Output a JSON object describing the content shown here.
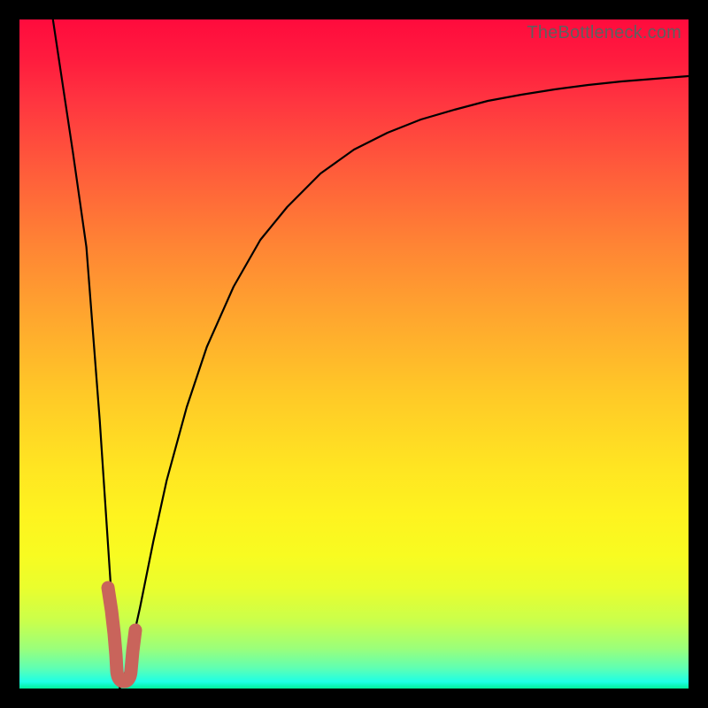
{
  "attribution": "TheBottleneck.com",
  "colors": {
    "frame": "#000000",
    "curve_stroke": "#000000",
    "marker_stroke": "#c9645b",
    "gradient_top": "#ff0b3d",
    "gradient_bottom": "#00ee9a"
  },
  "chart_data": {
    "type": "line",
    "title": "",
    "xlabel": "",
    "ylabel": "",
    "xlim": [
      0,
      100
    ],
    "ylim": [
      0,
      100
    ],
    "series": [
      {
        "name": "bottleneck-curve",
        "x": [
          5,
          8,
          10,
          12,
          14,
          14.5,
          15,
          16,
          18,
          20,
          22,
          25,
          28,
          32,
          36,
          40,
          45,
          50,
          55,
          60,
          65,
          70,
          75,
          80,
          85,
          90,
          95,
          100
        ],
        "values": [
          100,
          80,
          66,
          40,
          10,
          3,
          0,
          3,
          12,
          22,
          31,
          42,
          51,
          60,
          67,
          72,
          77,
          80.5,
          83,
          85,
          86.5,
          87.8,
          88.8,
          89.6,
          90.2,
          90.7,
          91.1,
          91.5
        ]
      }
    ],
    "marker": {
      "name": "current-config-J",
      "x_range": [
        13.2,
        16.8
      ],
      "y_range": [
        0,
        15
      ],
      "shape": "J"
    }
  }
}
